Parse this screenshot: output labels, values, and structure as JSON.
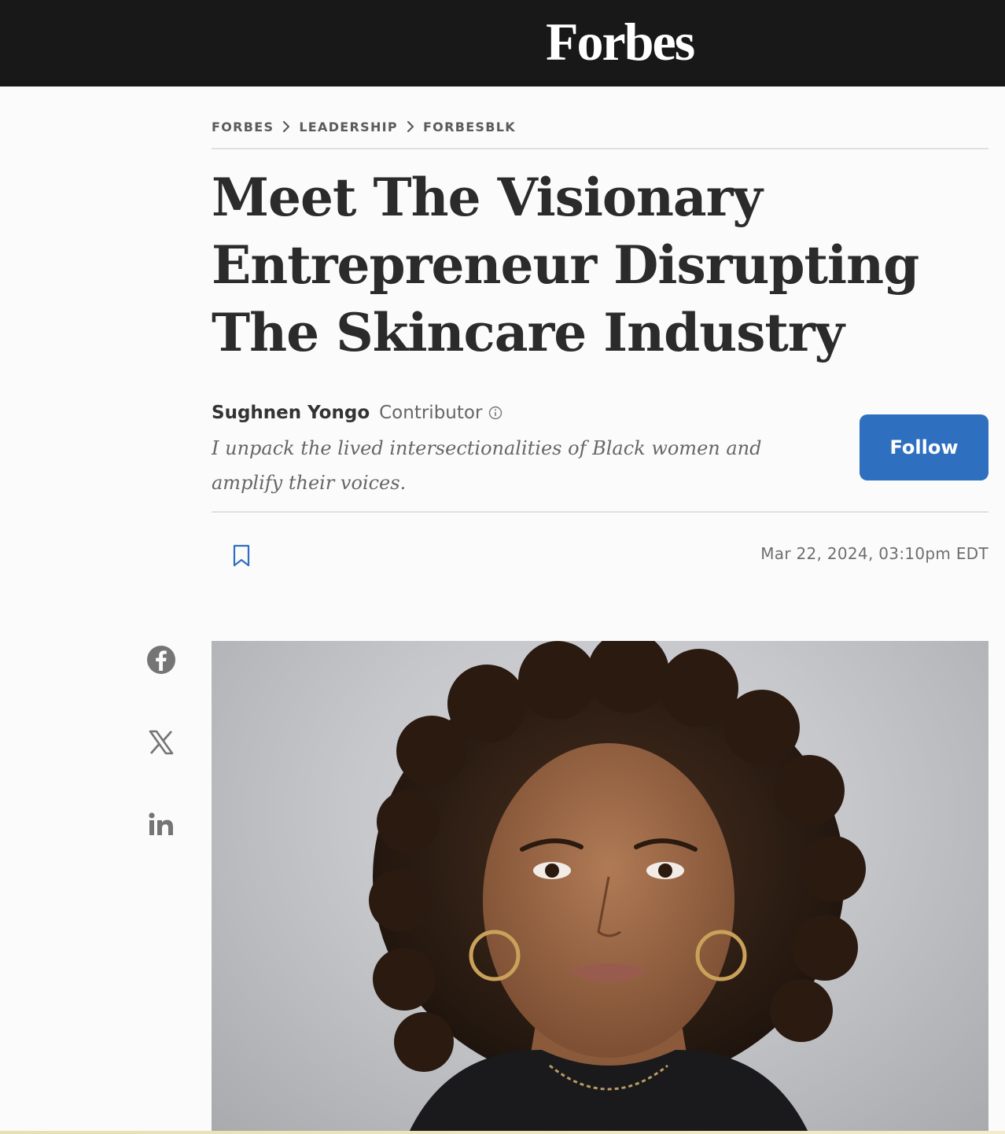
{
  "header": {
    "logo_text": "Forbes",
    "background_color": "#181818"
  },
  "breadcrumb": [
    "FORBES",
    "LEADERSHIP",
    "FORBESBLK"
  ],
  "article": {
    "headline": "Meet The Visionary Entrepreneur Disrupting The Skincare Industry",
    "author_name": "Sughnen Yongo",
    "author_role": "Contributor",
    "author_bio": "I unpack the lived intersectionalities of Black women and amplify their voices.",
    "follow_label": "Follow",
    "date": "Mar 22, 2024, 03:10pm EDT"
  },
  "share_icons": [
    "facebook-icon",
    "x-twitter-icon",
    "linkedin-icon"
  ],
  "bookmark_icon": "bookmark-icon",
  "colors": {
    "accent": "#2f6fbf",
    "headline": "#2b2b2b",
    "muted": "#666666"
  }
}
